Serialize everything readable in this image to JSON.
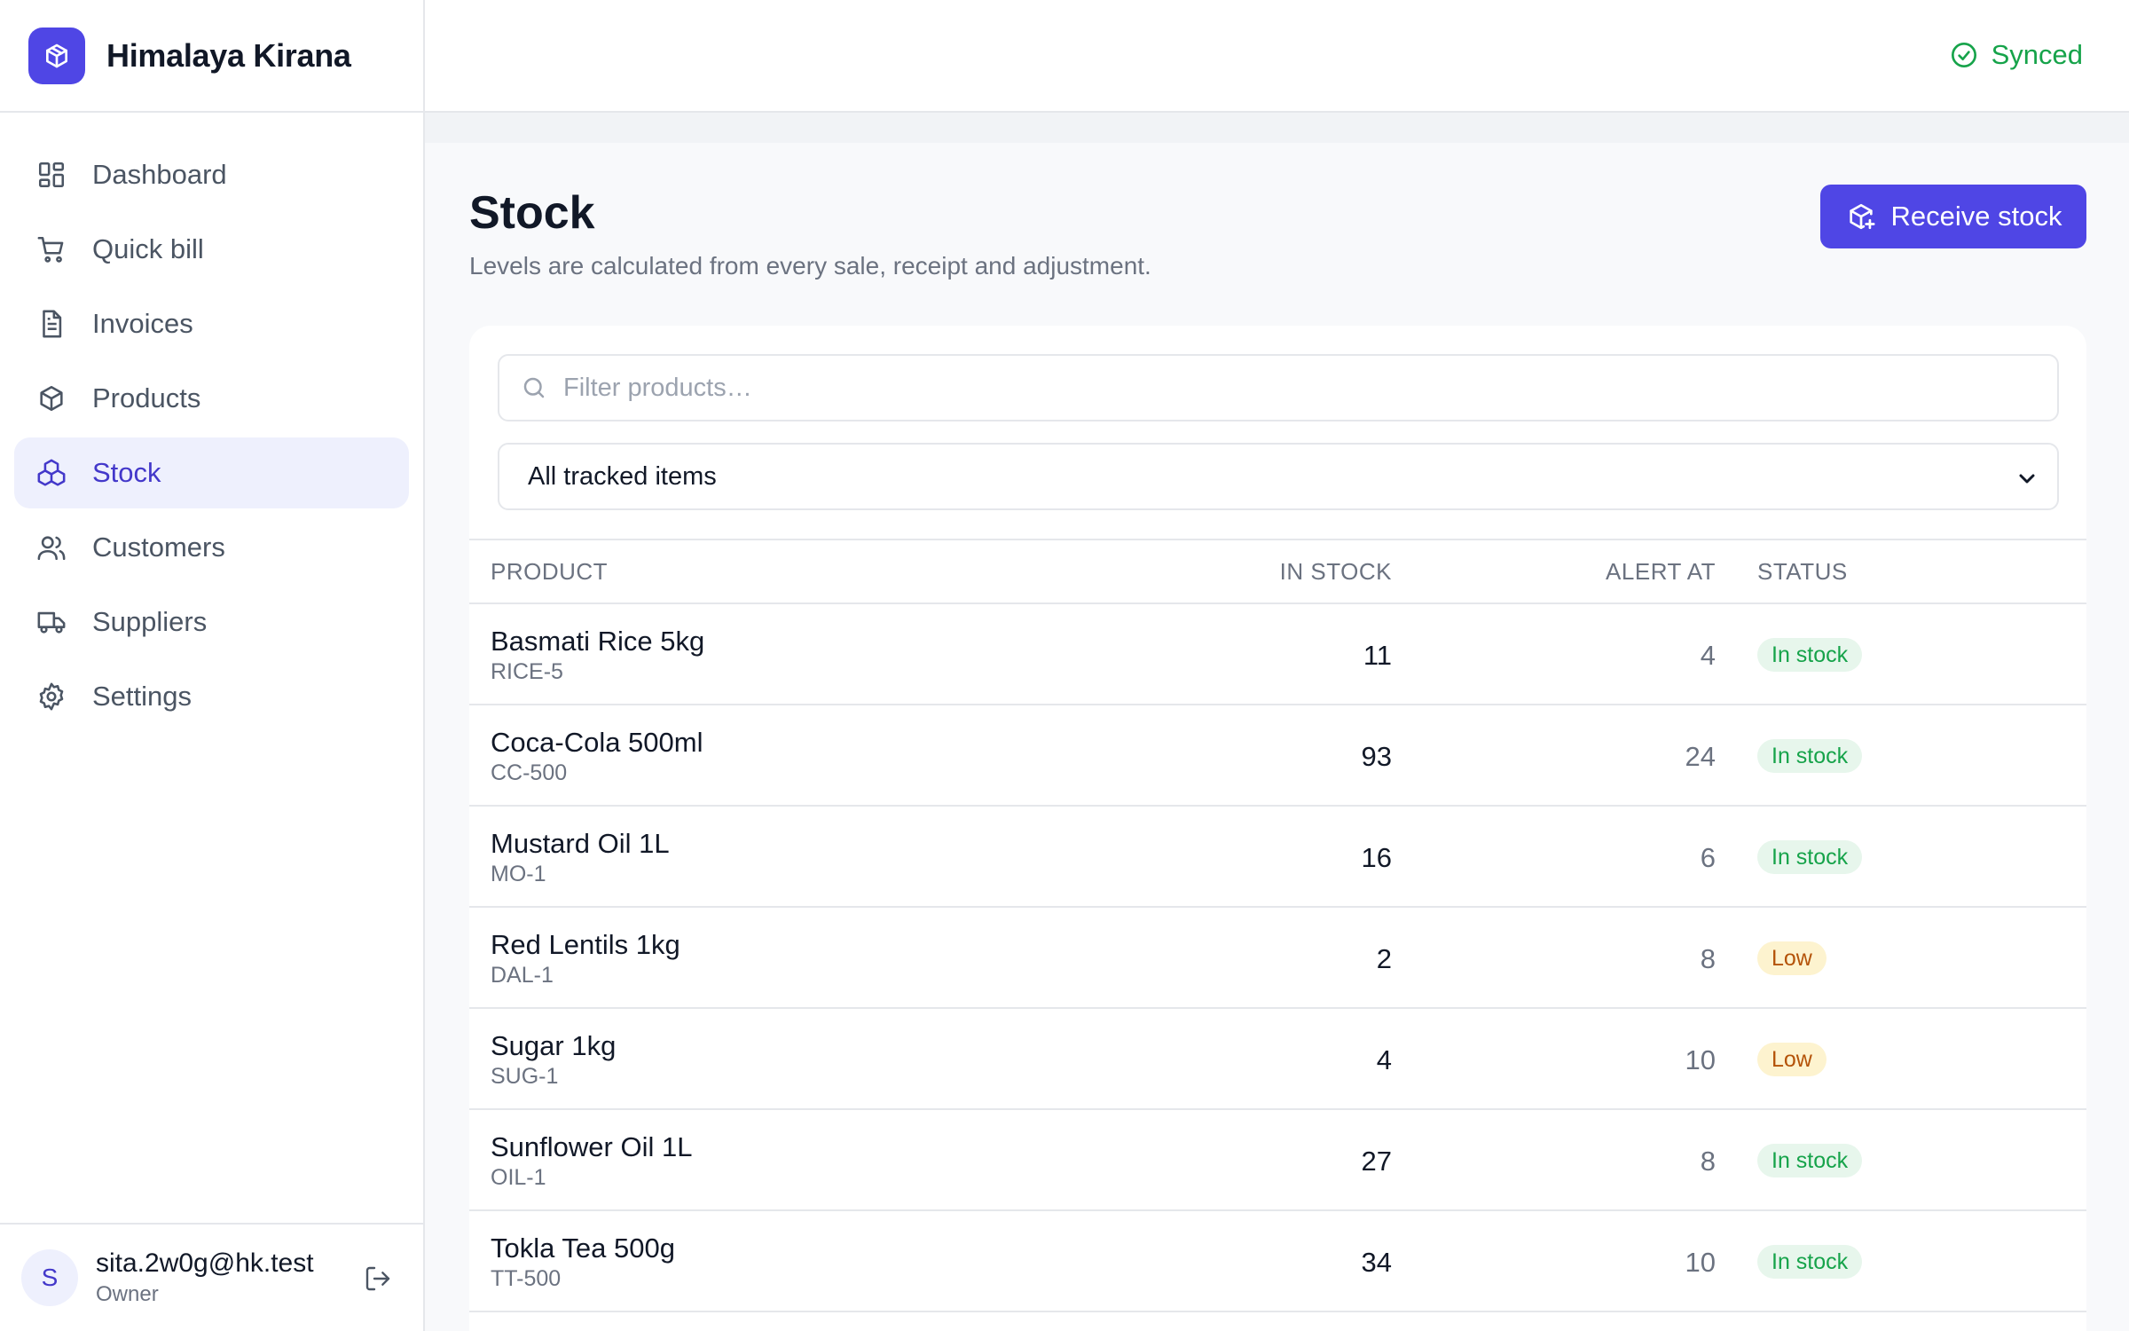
{
  "app": {
    "name": "Himalaya Kirana",
    "sync_status": "Synced"
  },
  "sidebar": {
    "items": [
      {
        "label": "Dashboard",
        "icon": "dashboard-icon",
        "active": false
      },
      {
        "label": "Quick bill",
        "icon": "cart-icon",
        "active": false
      },
      {
        "label": "Invoices",
        "icon": "document-icon",
        "active": false
      },
      {
        "label": "Products",
        "icon": "box-icon",
        "active": false
      },
      {
        "label": "Stock",
        "icon": "stack-icon",
        "active": true
      },
      {
        "label": "Customers",
        "icon": "users-icon",
        "active": false
      },
      {
        "label": "Suppliers",
        "icon": "truck-icon",
        "active": false
      },
      {
        "label": "Settings",
        "icon": "gear-icon",
        "active": false
      }
    ]
  },
  "user": {
    "initial": "S",
    "email": "sita.2w0g@hk.test",
    "role": "Owner"
  },
  "page": {
    "title": "Stock",
    "subtitle": "Levels are calculated from every sale, receipt and adjustment.",
    "receive_button": "Receive stock"
  },
  "filters": {
    "search_placeholder": "Filter products…",
    "select_value": "All tracked items"
  },
  "table": {
    "headers": {
      "product": "PRODUCT",
      "in_stock": "IN STOCK",
      "alert_at": "ALERT AT",
      "status": "STATUS"
    },
    "rows": [
      {
        "name": "Basmati Rice 5kg",
        "sku": "RICE-5",
        "in_stock": "11",
        "alert_at": "4",
        "status": "In stock",
        "level": "ok"
      },
      {
        "name": "Coca-Cola 500ml",
        "sku": "CC-500",
        "in_stock": "93",
        "alert_at": "24",
        "status": "In stock",
        "level": "ok"
      },
      {
        "name": "Mustard Oil 1L",
        "sku": "MO-1",
        "in_stock": "16",
        "alert_at": "6",
        "status": "In stock",
        "level": "ok"
      },
      {
        "name": "Red Lentils 1kg",
        "sku": "DAL-1",
        "in_stock": "2",
        "alert_at": "8",
        "status": "Low",
        "level": "low"
      },
      {
        "name": "Sugar 1kg",
        "sku": "SUG-1",
        "in_stock": "4",
        "alert_at": "10",
        "status": "Low",
        "level": "low"
      },
      {
        "name": "Sunflower Oil 1L",
        "sku": "OIL-1",
        "in_stock": "27",
        "alert_at": "8",
        "status": "In stock",
        "level": "ok"
      },
      {
        "name": "Tokla Tea 500g",
        "sku": "TT-500",
        "in_stock": "34",
        "alert_at": "10",
        "status": "In stock",
        "level": "ok"
      }
    ]
  },
  "colors": {
    "accent": "#4f46e5",
    "active_bg": "#eef0fd",
    "synced": "#16a34a",
    "badge_ok_bg": "#e7f6ec",
    "badge_low_bg": "#fdf3cf",
    "badge_low_text": "#b45309"
  }
}
